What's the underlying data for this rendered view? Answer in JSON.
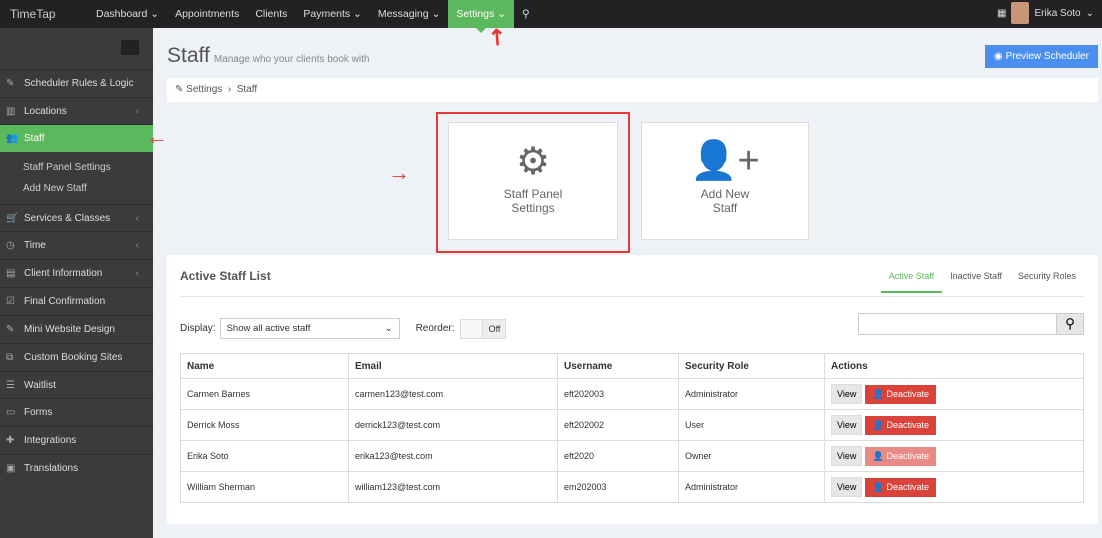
{
  "brand": "TimeTap",
  "nav": [
    "Dashboard",
    "Appointments",
    "Clients",
    "Payments",
    "Messaging",
    "Settings"
  ],
  "user": "Erika Soto",
  "sidebar": {
    "items": [
      "Scheduler Rules & Logic",
      "Locations",
      "Staff",
      "Services & Classes",
      "Time",
      "Client Information",
      "Final Confirmation",
      "Mini Website Design",
      "Custom Booking Sites",
      "Waitlist",
      "Forms",
      "Integrations",
      "Translations"
    ],
    "sub": [
      "Staff Panel Settings",
      "Add New Staff"
    ]
  },
  "page": {
    "title": "Staff",
    "subtitle": "Manage who your clients book with",
    "preview": "Preview Scheduler",
    "crumb": [
      "Settings",
      "Staff"
    ]
  },
  "cards": [
    {
      "label1": "Staff Panel",
      "label2": "Settings"
    },
    {
      "label1": "Add New",
      "label2": "Staff"
    }
  ],
  "list": {
    "title": "Active Staff List",
    "tabs": [
      "Active Staff",
      "Inactive Staff",
      "Security Roles"
    ],
    "display_label": "Display:",
    "display_value": "Show all active staff",
    "reorder_label": "Reorder:",
    "reorder_value": "Off",
    "columns": [
      "Name",
      "Email",
      "Username",
      "Security Role",
      "Actions"
    ],
    "rows": [
      [
        "Carmen Barnes",
        "carmen123@test.com",
        "eft202003",
        "Administrator"
      ],
      [
        "Derrick Moss",
        "derrick123@test.com",
        "eft202002",
        "User"
      ],
      [
        "Erika Soto",
        "erika123@test.com",
        "eft2020",
        "Owner"
      ],
      [
        "William Sherman",
        "william123@test.com",
        "em202003",
        "Administrator"
      ]
    ],
    "view": "View",
    "deactivate": "Deactivate"
  }
}
